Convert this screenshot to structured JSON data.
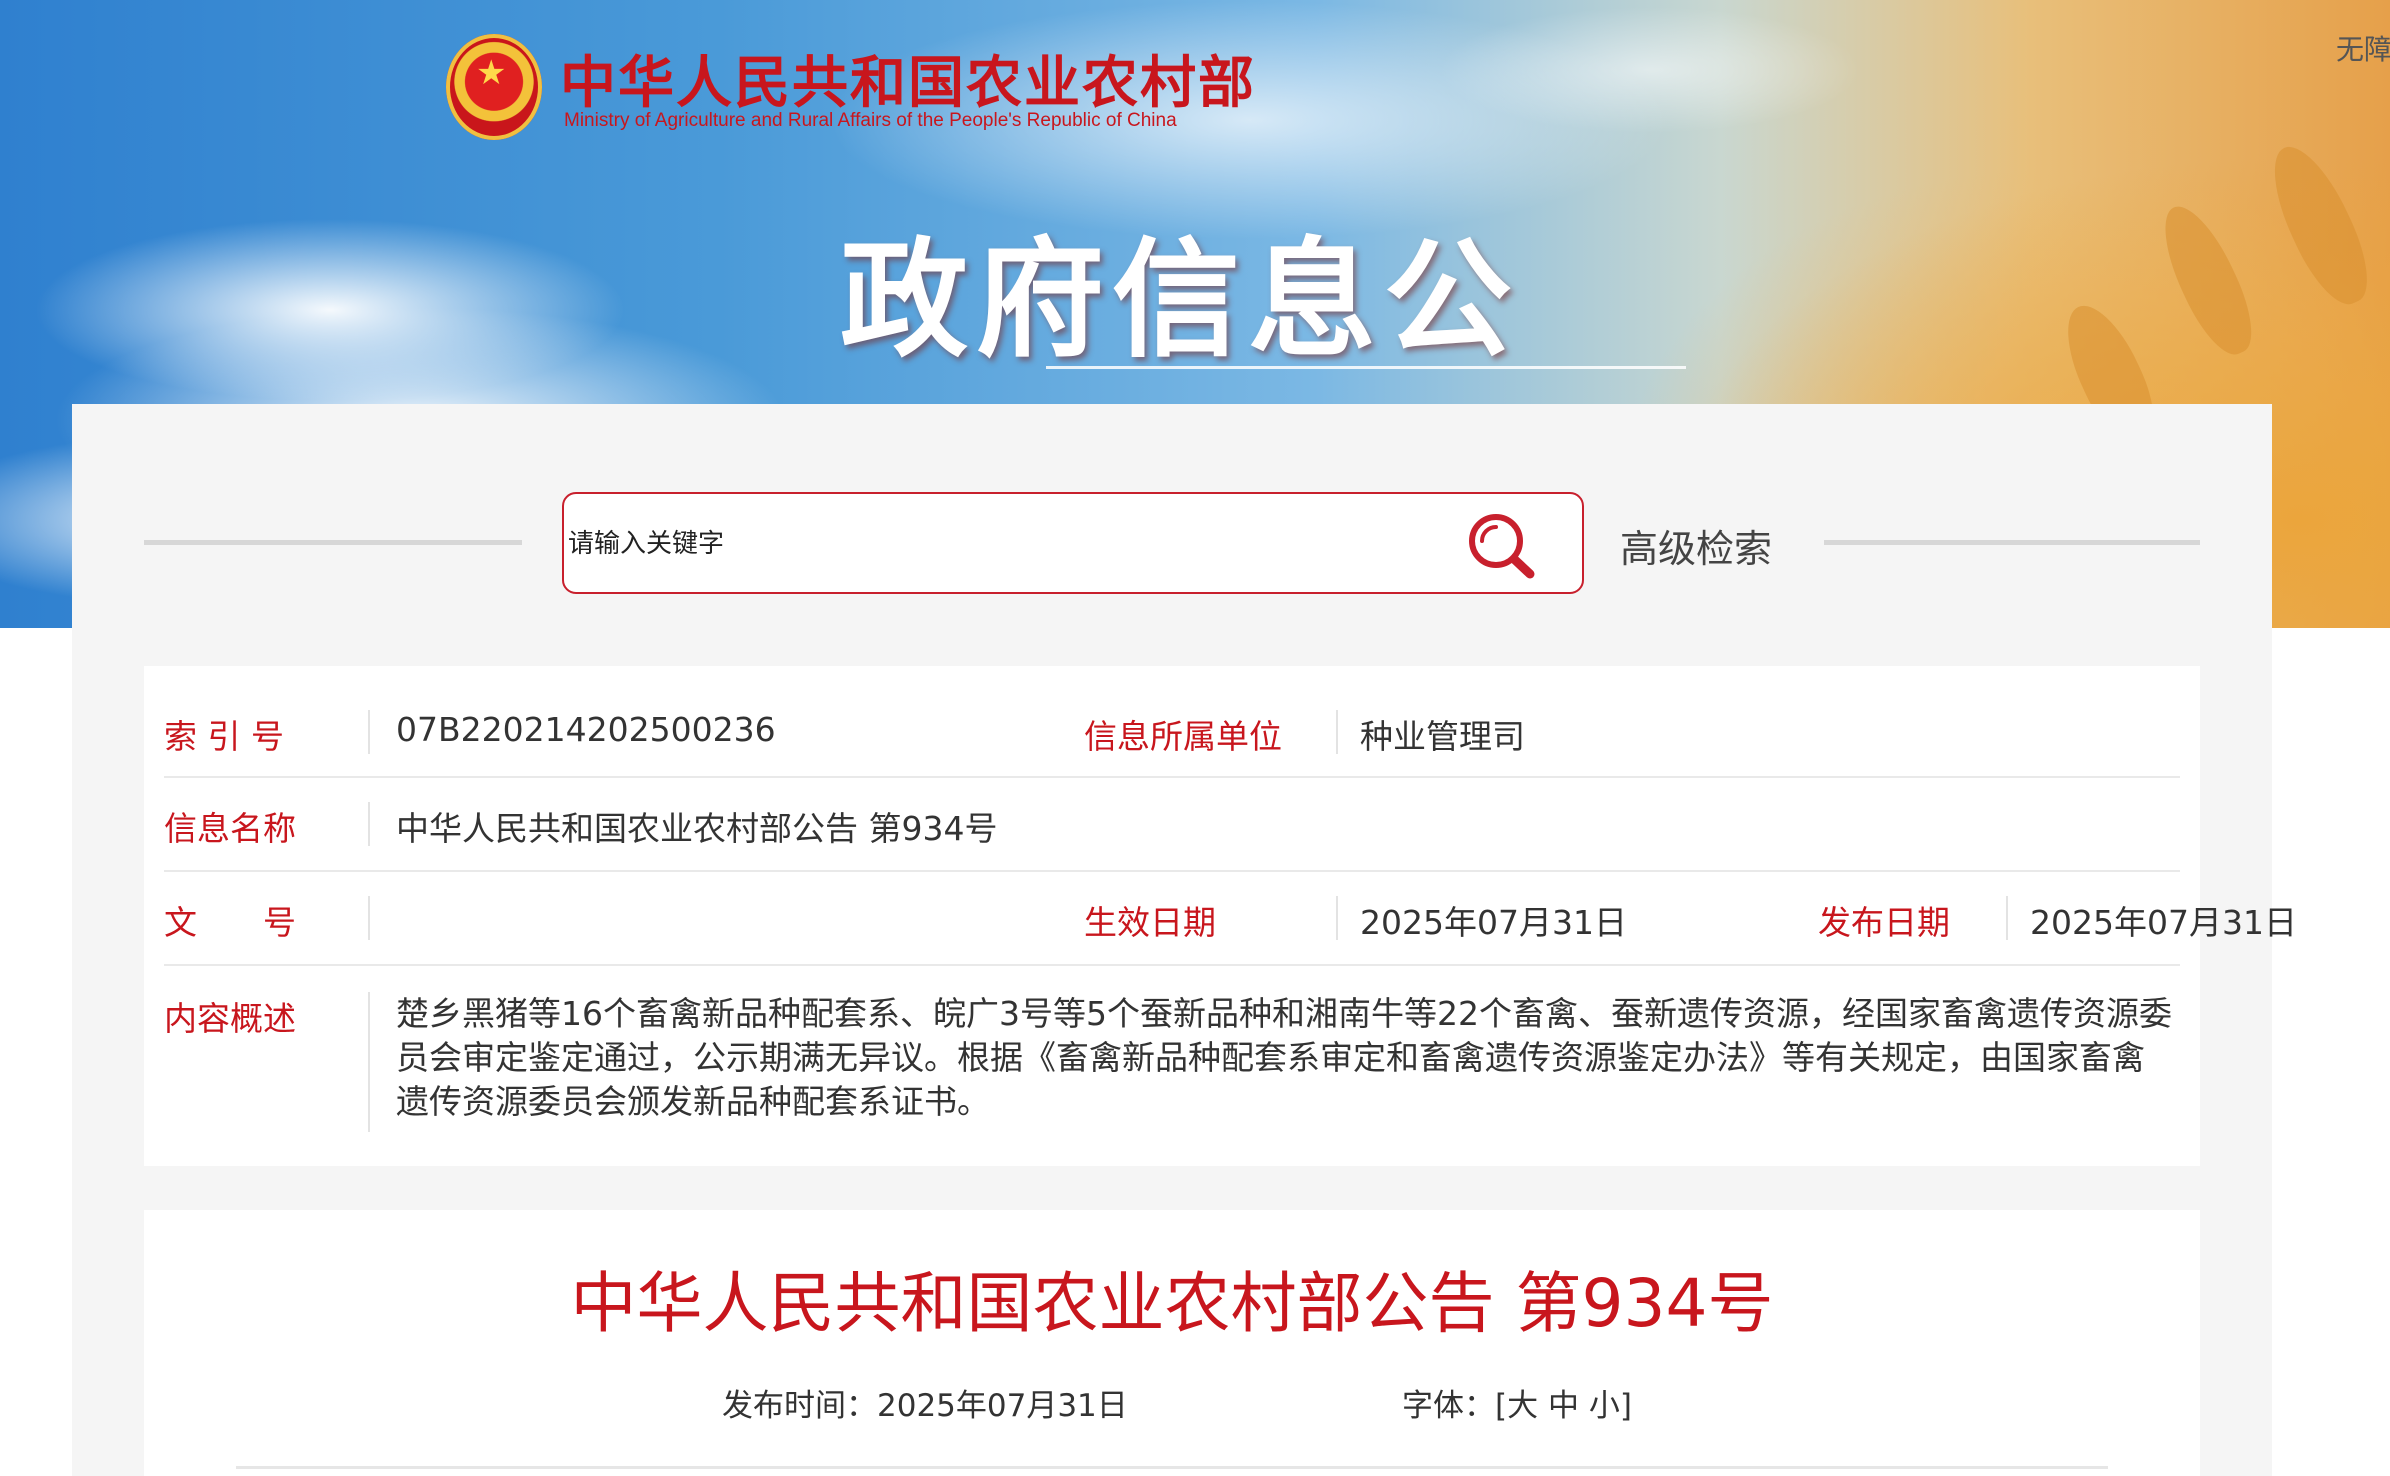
{
  "header": {
    "org_name_cn": "中华人民共和国农业农村部",
    "org_name_en": "Ministry of Agriculture and Rural Affairs of the People's Republic of China",
    "accessibility_link": "无障碍",
    "section_title": "政府信息公开"
  },
  "search": {
    "placeholder": "请输入关键字",
    "advanced_label": "高级检索",
    "accent_color": "#c8202d"
  },
  "info": {
    "index_label": "索 引 号",
    "index_value": "07B220214202500236",
    "unit_label": "信息所属单位",
    "unit_value": "种业管理司",
    "name_label": "信息名称",
    "name_value": "中华人民共和国农业农村部公告 第934号",
    "doc_no_label": "文　　号",
    "doc_no_value": "",
    "effective_label": "生效日期",
    "effective_value": "2025年07月31日",
    "publish_label": "发布日期",
    "publish_value": "2025年07月31日",
    "summary_label": "内容概述",
    "summary_value": "楚乡黑猪等16个畜禽新品种配套系、皖广3号等5个蚕新品种和湘南牛等22个畜禽、蚕新遗传资源，经国家畜禽遗传资源委员会审定鉴定通过，公示期满无异议。根据《畜禽新品种配套系审定和畜禽遗传资源鉴定办法》等有关规定，由国家畜禽遗传资源委员会颁发新品种配套系证书。"
  },
  "article": {
    "title": "中华人民共和国农业农村部公告 第934号",
    "publish_time_label": "发布时间：",
    "publish_time_value": "2025年07月31日",
    "font_size_label": "字体：",
    "bracket_open": "[",
    "font_large": "大",
    "font_medium": "中",
    "font_small": "小",
    "bracket_close": "]"
  },
  "colors": {
    "brand_red": "#c8161d",
    "panel_bg": "#f5f5f5"
  },
  "icons": {
    "search": "search-icon",
    "emblem": "national-emblem-icon"
  }
}
